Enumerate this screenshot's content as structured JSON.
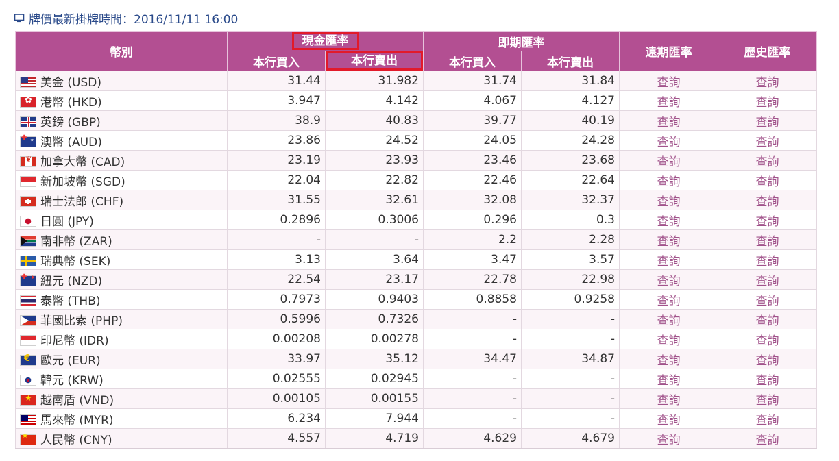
{
  "header": {
    "update_label": "牌價最新掛牌時間：2016/11/11 16:00",
    "icon": "monitor-icon"
  },
  "table": {
    "col_currency": "幣別",
    "group_cash": "現金匯率",
    "group_spot": "即期匯率",
    "col_forward": "遠期匯率",
    "col_history": "歷史匯率",
    "sub_buy": "本行買入",
    "sub_sell": "本行賣出",
    "highlight_color": "#e21a2a",
    "header_bg": "#b34f92",
    "link_color": "#a1538b",
    "rows": [
      {
        "flag": "usd",
        "name": "美金 (USD)",
        "cash_buy": "31.44",
        "cash_sell": "31.982",
        "spot_buy": "31.74",
        "spot_sell": "31.84",
        "forward": "查詢",
        "history": "查詢"
      },
      {
        "flag": "hkd",
        "name": "港幣 (HKD)",
        "cash_buy": "3.947",
        "cash_sell": "4.142",
        "spot_buy": "4.067",
        "spot_sell": "4.127",
        "forward": "查詢",
        "history": "查詢"
      },
      {
        "flag": "gbp",
        "name": "英鎊 (GBP)",
        "cash_buy": "38.9",
        "cash_sell": "40.83",
        "spot_buy": "39.77",
        "spot_sell": "40.19",
        "forward": "查詢",
        "history": "查詢"
      },
      {
        "flag": "aud",
        "name": "澳幣 (AUD)",
        "cash_buy": "23.86",
        "cash_sell": "24.52",
        "spot_buy": "24.05",
        "spot_sell": "24.28",
        "forward": "查詢",
        "history": "查詢"
      },
      {
        "flag": "cad",
        "name": "加拿大幣 (CAD)",
        "cash_buy": "23.19",
        "cash_sell": "23.93",
        "spot_buy": "23.46",
        "spot_sell": "23.68",
        "forward": "查詢",
        "history": "查詢"
      },
      {
        "flag": "sgd",
        "name": "新加坡幣 (SGD)",
        "cash_buy": "22.04",
        "cash_sell": "22.82",
        "spot_buy": "22.46",
        "spot_sell": "22.64",
        "forward": "查詢",
        "history": "查詢"
      },
      {
        "flag": "chf",
        "name": "瑞士法郎 (CHF)",
        "cash_buy": "31.55",
        "cash_sell": "32.61",
        "spot_buy": "32.08",
        "spot_sell": "32.37",
        "forward": "查詢",
        "history": "查詢"
      },
      {
        "flag": "jpy",
        "name": "日圓 (JPY)",
        "cash_buy": "0.2896",
        "cash_sell": "0.3006",
        "spot_buy": "0.296",
        "spot_sell": "0.3",
        "forward": "查詢",
        "history": "查詢"
      },
      {
        "flag": "zar",
        "name": "南非幣 (ZAR)",
        "cash_buy": "-",
        "cash_sell": "-",
        "spot_buy": "2.2",
        "spot_sell": "2.28",
        "forward": "查詢",
        "history": "查詢"
      },
      {
        "flag": "sek",
        "name": "瑞典幣 (SEK)",
        "cash_buy": "3.13",
        "cash_sell": "3.64",
        "spot_buy": "3.47",
        "spot_sell": "3.57",
        "forward": "查詢",
        "history": "查詢"
      },
      {
        "flag": "nzd",
        "name": "紐元 (NZD)",
        "cash_buy": "22.54",
        "cash_sell": "23.17",
        "spot_buy": "22.78",
        "spot_sell": "22.98",
        "forward": "查詢",
        "history": "查詢"
      },
      {
        "flag": "thb",
        "name": "泰幣 (THB)",
        "cash_buy": "0.7973",
        "cash_sell": "0.9403",
        "spot_buy": "0.8858",
        "spot_sell": "0.9258",
        "forward": "查詢",
        "history": "查詢"
      },
      {
        "flag": "php",
        "name": "菲國比索 (PHP)",
        "cash_buy": "0.5996",
        "cash_sell": "0.7326",
        "spot_buy": "-",
        "spot_sell": "-",
        "forward": "查詢",
        "history": "查詢"
      },
      {
        "flag": "idr",
        "name": "印尼幣 (IDR)",
        "cash_buy": "0.00208",
        "cash_sell": "0.00278",
        "spot_buy": "-",
        "spot_sell": "-",
        "forward": "查詢",
        "history": "查詢"
      },
      {
        "flag": "eur",
        "name": "歐元 (EUR)",
        "cash_buy": "33.97",
        "cash_sell": "35.12",
        "spot_buy": "34.47",
        "spot_sell": "34.87",
        "forward": "查詢",
        "history": "查詢"
      },
      {
        "flag": "krw",
        "name": "韓元 (KRW)",
        "cash_buy": "0.02555",
        "cash_sell": "0.02945",
        "spot_buy": "-",
        "spot_sell": "-",
        "forward": "查詢",
        "history": "查詢"
      },
      {
        "flag": "vnd",
        "name": "越南盾 (VND)",
        "cash_buy": "0.00105",
        "cash_sell": "0.00155",
        "spot_buy": "-",
        "spot_sell": "-",
        "forward": "查詢",
        "history": "查詢"
      },
      {
        "flag": "myr",
        "name": "馬來幣 (MYR)",
        "cash_buy": "6.234",
        "cash_sell": "7.944",
        "spot_buy": "-",
        "spot_sell": "-",
        "forward": "查詢",
        "history": "查詢"
      },
      {
        "flag": "cny",
        "name": "人民幣 (CNY)",
        "cash_buy": "4.557",
        "cash_sell": "4.719",
        "spot_buy": "4.629",
        "spot_sell": "4.679",
        "forward": "查詢",
        "history": "查詢"
      }
    ]
  }
}
